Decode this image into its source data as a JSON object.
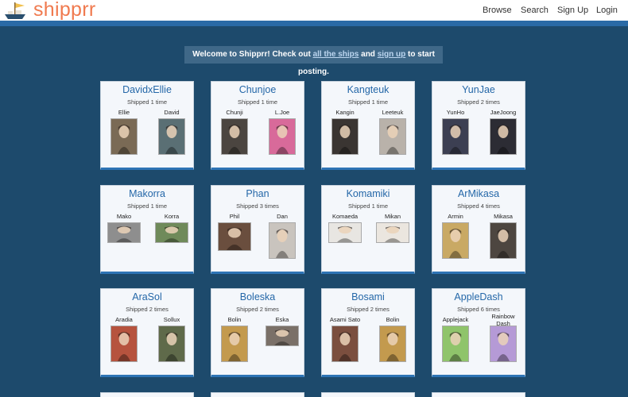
{
  "header": {
    "logo_text": "shipprr",
    "nav": [
      {
        "label": "Browse"
      },
      {
        "label": "Search"
      },
      {
        "label": "Sign Up"
      },
      {
        "label": "Login"
      }
    ]
  },
  "welcome": {
    "prefix": "Welcome to Shipprr! Check out ",
    "link1": "all the ships",
    "middle": " and ",
    "link2": "sign up",
    "suffix": " to start posting."
  },
  "ships": [
    {
      "name": "DavidxEllie",
      "count": "Shipped 1 time",
      "chars": [
        {
          "name": "Ellie",
          "tone": "#7a6a55"
        },
        {
          "name": "David",
          "tone": "#5a6f74"
        }
      ]
    },
    {
      "name": "Chunjoe",
      "count": "Shipped 1 time",
      "chars": [
        {
          "name": "Chunji",
          "tone": "#4b4540"
        },
        {
          "name": "L.Joe",
          "tone": "#d86a9a"
        }
      ]
    },
    {
      "name": "Kangteuk",
      "count": "Shipped 1 time",
      "chars": [
        {
          "name": "Kangin",
          "tone": "#3a3532"
        },
        {
          "name": "Leeteuk",
          "tone": "#b9b2aa"
        }
      ]
    },
    {
      "name": "YunJae",
      "count": "Shipped 2 times",
      "chars": [
        {
          "name": "YunHo",
          "tone": "#3c3f52"
        },
        {
          "name": "JaeJoong",
          "tone": "#2c2c34"
        }
      ]
    },
    {
      "name": "Makorra",
      "count": "Shipped 1 time",
      "chars": [
        {
          "name": "Mako",
          "tone": "#8e8e8e"
        },
        {
          "name": "Korra",
          "tone": "#6f8a5a"
        }
      ]
    },
    {
      "name": "Phan",
      "count": "Shipped 3 times",
      "chars": [
        {
          "name": "Phil",
          "tone": "#6a4e3e"
        },
        {
          "name": "Dan",
          "tone": "#c9c4be"
        }
      ]
    },
    {
      "name": "Komamiki",
      "count": "Shipped 1 time",
      "chars": [
        {
          "name": "Komaeda",
          "tone": "#e8e6e2"
        },
        {
          "name": "Mikan",
          "tone": "#ebe6df"
        }
      ]
    },
    {
      "name": "ArMikasa",
      "count": "Shipped 4 times",
      "chars": [
        {
          "name": "Armin",
          "tone": "#c9a964"
        },
        {
          "name": "Mikasa",
          "tone": "#4d4640"
        }
      ]
    },
    {
      "name": "AraSol",
      "count": "Shipped 2 times",
      "chars": [
        {
          "name": "Aradia",
          "tone": "#b6533e"
        },
        {
          "name": "Sollux",
          "tone": "#5f6a4a"
        }
      ]
    },
    {
      "name": "Boleska",
      "count": "Shipped 2 times",
      "chars": [
        {
          "name": "Bolin",
          "tone": "#c39a4e"
        },
        {
          "name": "Eska",
          "tone": "#7a7068"
        }
      ]
    },
    {
      "name": "Bosami",
      "count": "Shipped 2 times",
      "chars": [
        {
          "name": "Asami Sato",
          "tone": "#7b4f3f"
        },
        {
          "name": "Bolin",
          "tone": "#c39a4e"
        }
      ]
    },
    {
      "name": "AppleDash",
      "count": "Shipped 6 times",
      "chars": [
        {
          "name": "Applejack",
          "tone": "#8fc46b"
        },
        {
          "name": "Rainbow Dash",
          "tone": "#b59ad6"
        }
      ]
    }
  ],
  "colors": {
    "background": "#1d4a6c",
    "brand": "#f07a4f",
    "card_title": "#2467a8",
    "card_accent": "#2e74b5"
  }
}
